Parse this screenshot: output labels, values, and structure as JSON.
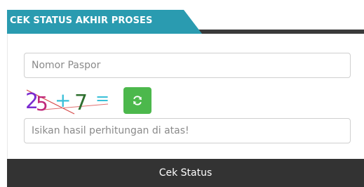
{
  "header": {
    "title": "CEK STATUS AKHIR PROSES"
  },
  "form": {
    "passport_placeholder": "Nomor Paspor",
    "passport_value": "",
    "answer_placeholder": "Isikan hasil perhitungan di atas!",
    "answer_value": "",
    "captcha": {
      "chars": [
        "2",
        "5",
        "+",
        "7",
        "="
      ],
      "refresh_icon": "refresh-icon"
    },
    "submit_label": "Cek Status"
  },
  "colors": {
    "tab": "#2a9bb0",
    "tab_rule": "#3a3a3a",
    "refresh": "#4cb84c",
    "submit_bg": "#333333"
  }
}
